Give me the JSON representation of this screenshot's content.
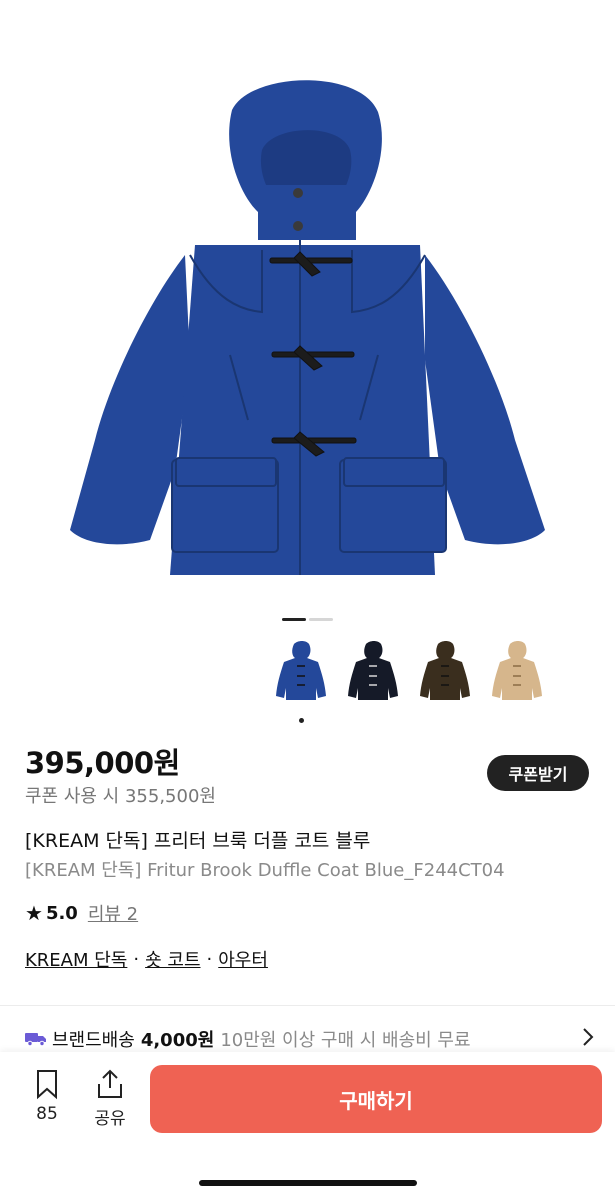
{
  "product": {
    "price": "395,000원",
    "coupon_price": "쿠폰 사용 시 355,500원",
    "coupon_button": "쿠폰받기",
    "title_ko": "[KREAM 단독] 프리터 브룩 더플 코트 블루",
    "title_en": "[KREAM 단독] Fritur Brook Duffle Coat Blue_F244CT04",
    "rating": "5.0",
    "reviews": "리뷰 2",
    "tags": [
      "KREAM 단독",
      "숏 코트",
      "아우터"
    ],
    "tag_separator": "·"
  },
  "gallery": {
    "image_icon": "duffle-coat-blue",
    "page_count": 2,
    "active_page": 1,
    "variants": [
      {
        "color": "#24489a",
        "selected": true
      },
      {
        "color": "#151a28",
        "selected": false
      },
      {
        "color": "#3a2e1e",
        "selected": false
      },
      {
        "color": "#d6b68c",
        "selected": false
      }
    ]
  },
  "shipping": {
    "icon": "truck-icon",
    "label": "브랜드배송",
    "fee": "4,000원",
    "note": "10만원 이상 구매 시 배송비 무료"
  },
  "bottom_bar": {
    "bookmark_count": "85",
    "share_label": "공유",
    "buy_label": "구매하기"
  },
  "colors": {
    "accent": "#ef6253",
    "coat_blue": "#24489a",
    "truck": "#6b5bd6"
  }
}
